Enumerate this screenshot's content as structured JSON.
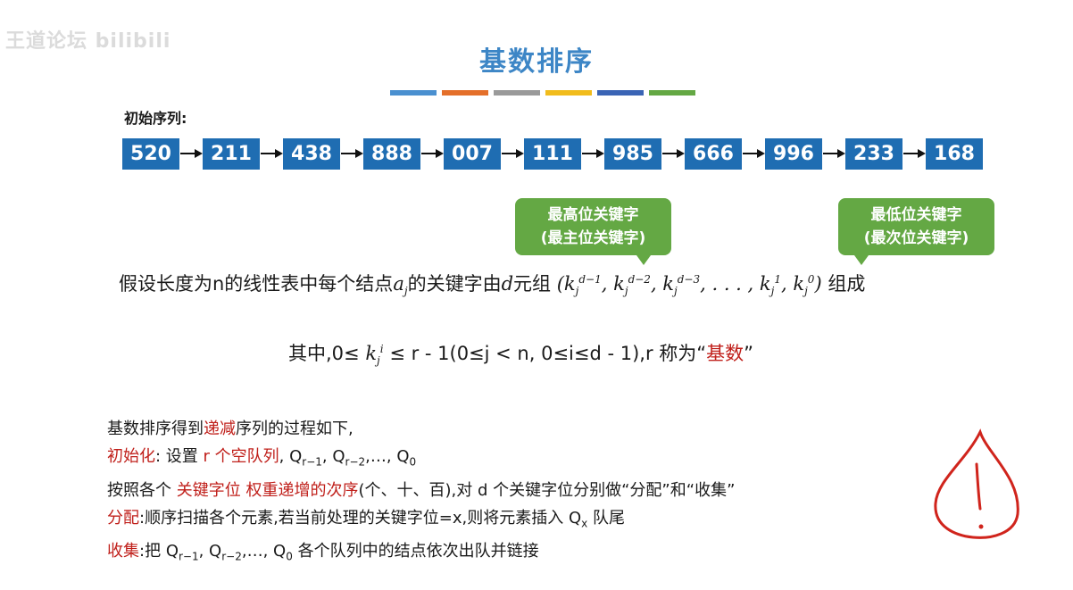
{
  "watermark": "王道论坛 bilibili",
  "title": "基数排序",
  "color_bar": [
    "#4a90d0",
    "#e46f2a",
    "#9a9a9a",
    "#f1bc1c",
    "#3a64b5",
    "#64a844"
  ],
  "sequence_label": "初始序列:",
  "sequence": [
    "520",
    "211",
    "438",
    "888",
    "007",
    "111",
    "985",
    "666",
    "996",
    "233",
    "168"
  ],
  "callouts": {
    "highest_line1": "最高位关键字",
    "highest_line2": "(最主位关键字)",
    "lowest_line1": "最低位关键字",
    "lowest_line2": "(最次位关键字)"
  },
  "statement": {
    "prefix": "假设长度为n的线性表中每个结点",
    "middle": "的关键字由",
    "tuple_word": "元组",
    "suffix": "组成"
  },
  "radix_line": {
    "prefix": "其中,0≤",
    "range": "≤ r - 1(0≤j < n, 0≤i≤d - 1),r 称为“",
    "keyword": "基数",
    "close": "”"
  },
  "process": {
    "intro_pre": "基数排序得到",
    "intro_red": "递减",
    "intro_post": "序列的过程如下,",
    "init_label": "初始化",
    "init_text": ": 设置",
    "init_red": "r 个空队列",
    "init_tail": ",",
    "order_pre": "按照各个",
    "order_red": "关键字位 权重递增的次序",
    "order_post": "(个、十、百),对 d 个关键字位分别做“分配”和“收集”",
    "distribute_label": "分配",
    "distribute_text": ":顺序扫描各个元素,若当前处理的关键字位=x,则将元素插入 Q",
    "distribute_tail": " 队尾",
    "collect_label": "收集",
    "collect_text": ":把",
    "collect_tail": "各个队列中的结点依次出队并链接"
  }
}
